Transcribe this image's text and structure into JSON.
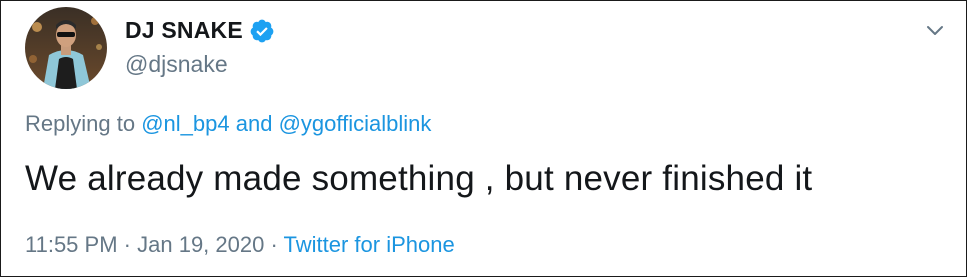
{
  "author": {
    "display_name": "DJ SNAKE",
    "handle": "@djsnake",
    "verified": true
  },
  "reply": {
    "prefix": "Replying to",
    "user1": "@nl_bp4",
    "conjunction": "and",
    "user2": "@ygofficialblink"
  },
  "tweet": {
    "text": "We already made something , but never finished it"
  },
  "meta": {
    "time": "11:55 PM",
    "separator1": "·",
    "date": "Jan 19, 2020",
    "separator2": "·",
    "source": "Twitter for iPhone"
  },
  "colors": {
    "accent": "#1b95e0",
    "verified": "#1da1f2",
    "secondary_text": "#657786",
    "primary_text": "#14171a"
  },
  "icons": {
    "verified": "verified-badge-icon",
    "more": "chevron-down-icon"
  }
}
